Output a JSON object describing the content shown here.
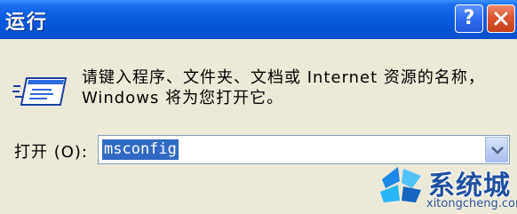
{
  "window": {
    "title": "运行",
    "help_label": "?",
    "close_icon": "close-icon"
  },
  "dialog": {
    "icon": "run-program-icon",
    "description": "请键入程序、文件夹、文档或 Internet 资源的名称，Windows 将为您打开它。",
    "open_label": "打开 (O):",
    "open_value": "msconfig"
  },
  "watermark": {
    "title": "系统城",
    "url": "xitongcheng.com"
  },
  "colors": {
    "titlebar": "#0A5BE0",
    "dialog_bg": "#ECE9D8",
    "selection": "#316AC5",
    "close_button": "#E0552F"
  }
}
